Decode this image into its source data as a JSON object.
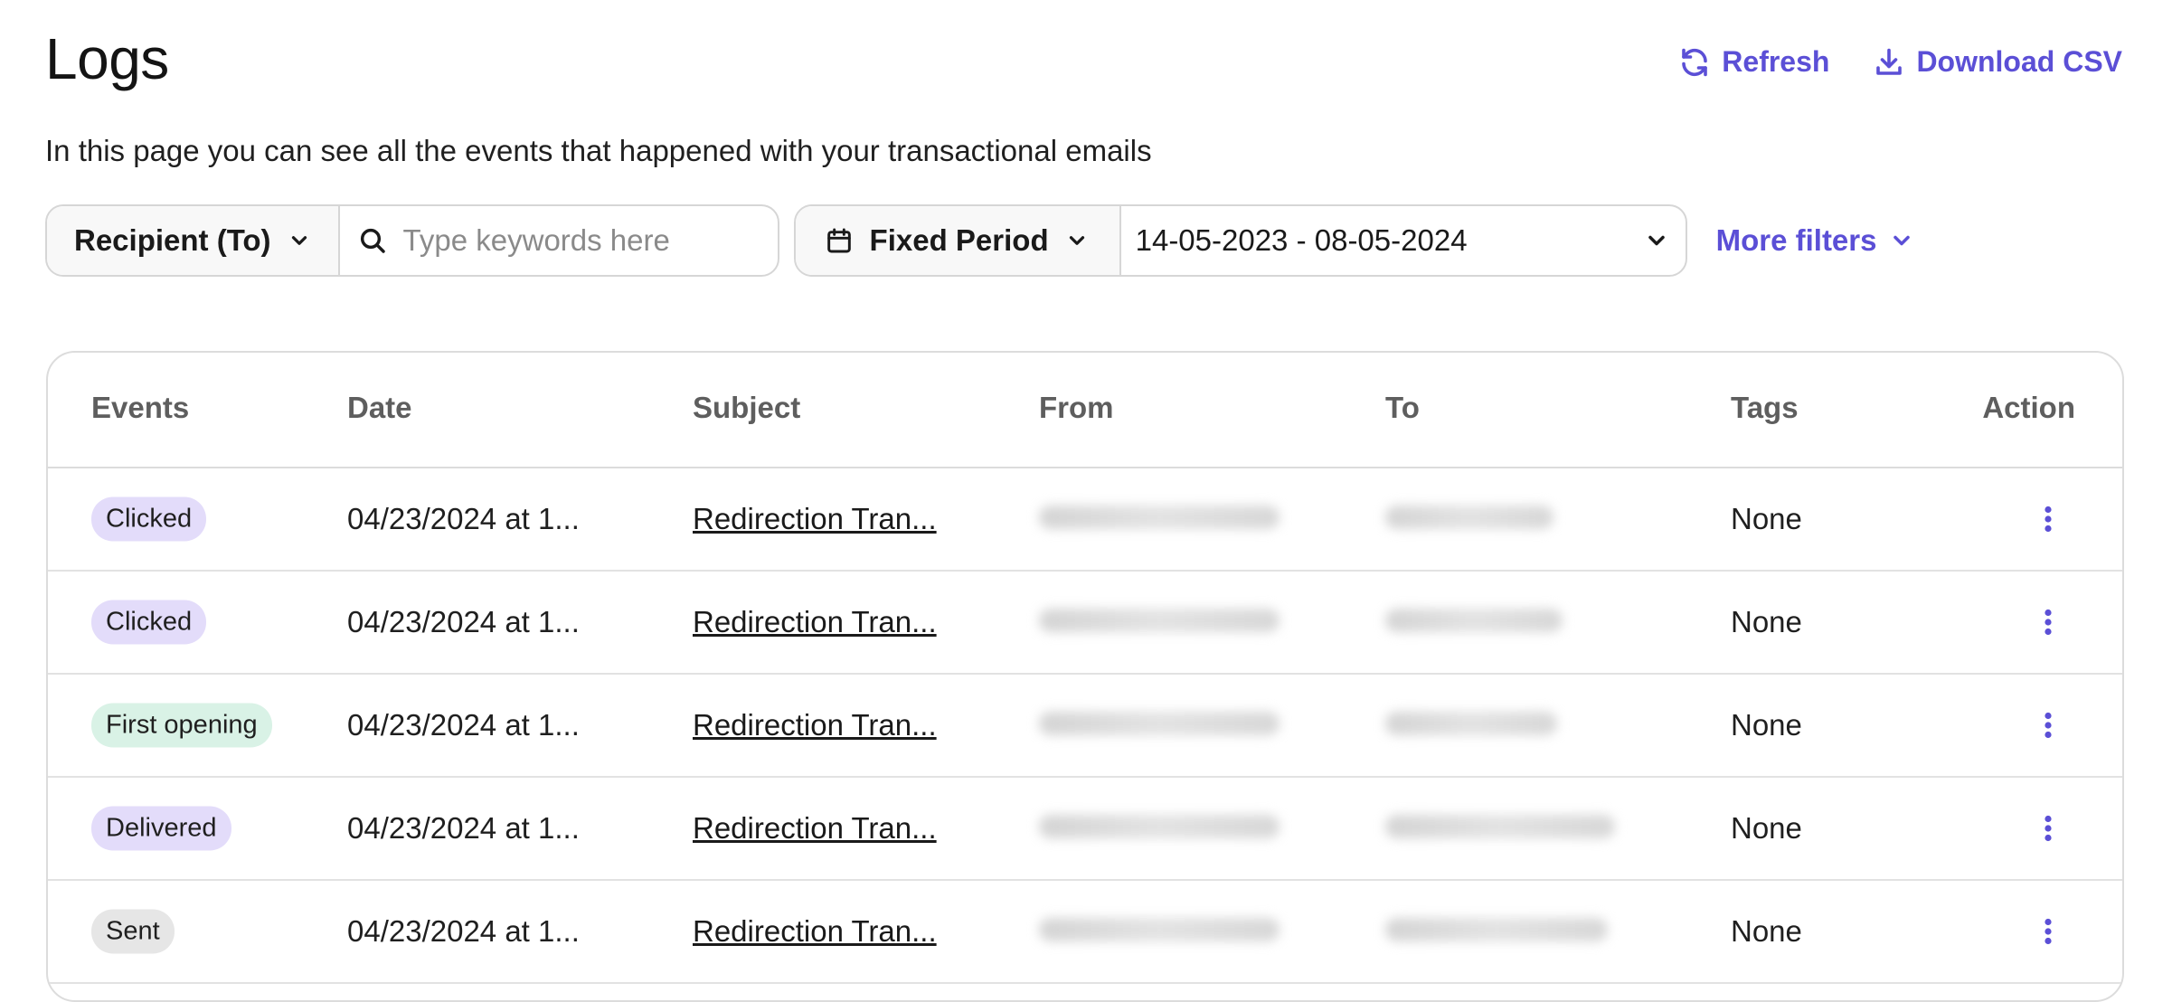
{
  "page": {
    "title": "Logs",
    "subtitle": "In this page you can see all the events that happened with your transactional emails"
  },
  "actions": {
    "refresh_label": "Refresh",
    "download_label": "Download CSV"
  },
  "filters": {
    "field_select": "Recipient (To)",
    "search_placeholder": "Type keywords here",
    "search_value": "",
    "period_select": "Fixed Period",
    "date_range": "14-05-2023 - 08-05-2024",
    "more_filters_label": "More filters"
  },
  "table": {
    "columns": [
      "Events",
      "Date",
      "Subject",
      "From",
      "To",
      "Tags",
      "Action"
    ],
    "rows": [
      {
        "event": "Clicked",
        "event_color": "#e3dcfa",
        "date": "04/23/2024 at 1...",
        "subject": "Redirection Tran...",
        "from": "",
        "to": "",
        "tags": "None"
      },
      {
        "event": "Clicked",
        "event_color": "#e3dcfa",
        "date": "04/23/2024 at 1...",
        "subject": "Redirection Tran...",
        "from": "",
        "to": "",
        "tags": "None"
      },
      {
        "event": "First opening",
        "event_color": "#d9f2e6",
        "date": "04/23/2024 at 1...",
        "subject": "Redirection Tran...",
        "from": "",
        "to": "",
        "tags": "None"
      },
      {
        "event": "Delivered",
        "event_color": "#e3dcfa",
        "date": "04/23/2024 at 1...",
        "subject": "Redirection Tran...",
        "from": "",
        "to": "",
        "tags": "None"
      },
      {
        "event": "Sent",
        "event_color": "#e6e6e6",
        "date": "04/23/2024 at 1...",
        "subject": "Redirection Tran...",
        "from": "",
        "to": "",
        "tags": "None"
      }
    ]
  },
  "colors": {
    "accent": "#5b4fd6",
    "border": "#d6d6d6"
  }
}
